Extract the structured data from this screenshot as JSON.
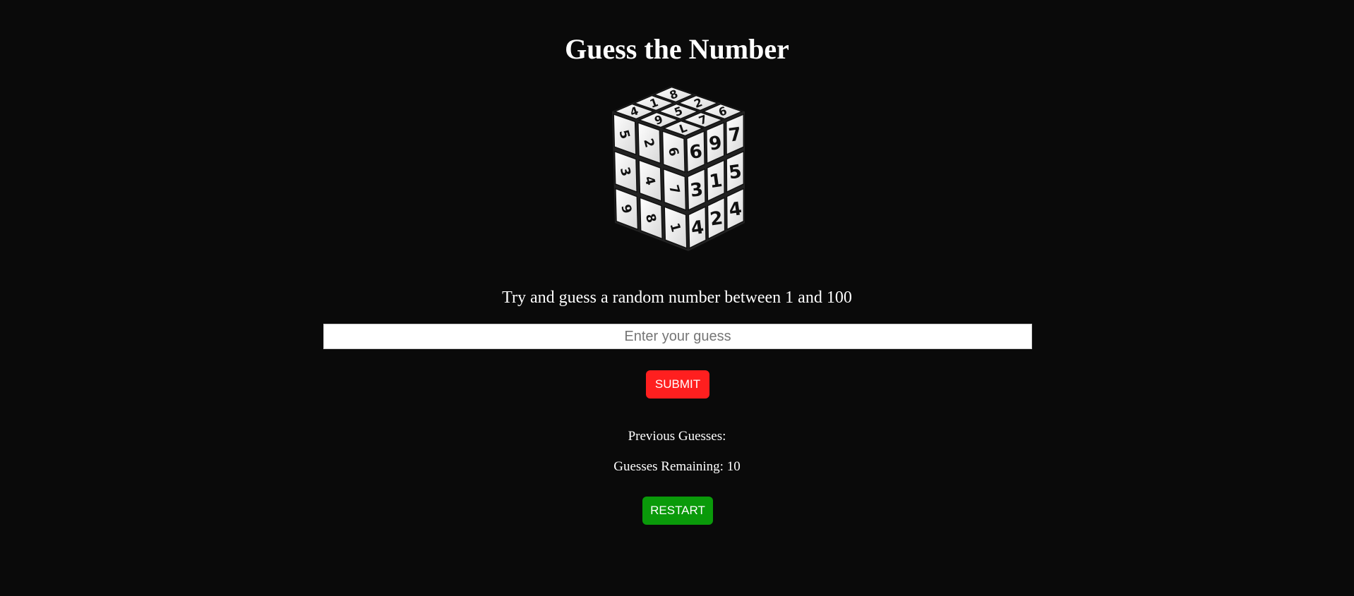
{
  "page": {
    "title": "Guess the Number",
    "instructions": "Try and guess a random number between 1 and 100",
    "image_alt": "numbered-cube"
  },
  "cube": {
    "front": [
      "6",
      "9",
      "7",
      "3",
      "1",
      "5",
      "4",
      "2",
      "4"
    ],
    "left": [
      "5",
      "2",
      "6",
      "3",
      "4",
      "7",
      "9",
      "8",
      "1"
    ],
    "top": [
      "4",
      "1",
      "8",
      "9",
      "5",
      "2",
      "L",
      "7",
      "6"
    ]
  },
  "form": {
    "input_value": "",
    "input_placeholder": "Enter your guess",
    "submit_label": "SUBMIT"
  },
  "status": {
    "previous_guesses_label": "Previous Guesses:",
    "previous_guesses": "",
    "guesses_remaining_label": "Guesses Remaining: 10",
    "restart_label": "RESTART"
  },
  "colors": {
    "background": "#0a0a0a",
    "submit": "#ff1f1f",
    "restart": "#0a9a0a",
    "text": "#ffffff"
  }
}
